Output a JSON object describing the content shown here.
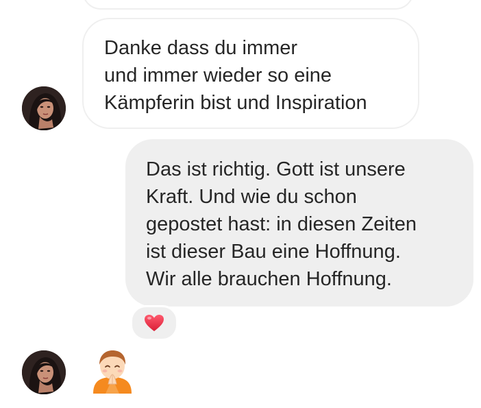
{
  "conversation": {
    "incoming_message": {
      "lines": [
        "Danke dass du immer",
        "und immer wieder so eine",
        "Kämpferin bist und Inspiration"
      ]
    },
    "outgoing_message": {
      "lines": [
        "Das ist richtig. Gott ist unsere",
        "Kraft. Und wie du schon",
        "gepostet hast: in diesen Zeiten",
        "ist dieser Bau eine Hoffnung.",
        "Wir alle brauchen Hoffnung."
      ],
      "reaction": "heart-icon"
    },
    "emoji_message": {
      "icon": "praying-person-icon"
    }
  },
  "colors": {
    "outgoing_bubble": "#efefef",
    "incoming_border": "#efefef",
    "text": "#262626",
    "heart": "#ed4956",
    "emoji_shirt": "#f58a1f"
  }
}
